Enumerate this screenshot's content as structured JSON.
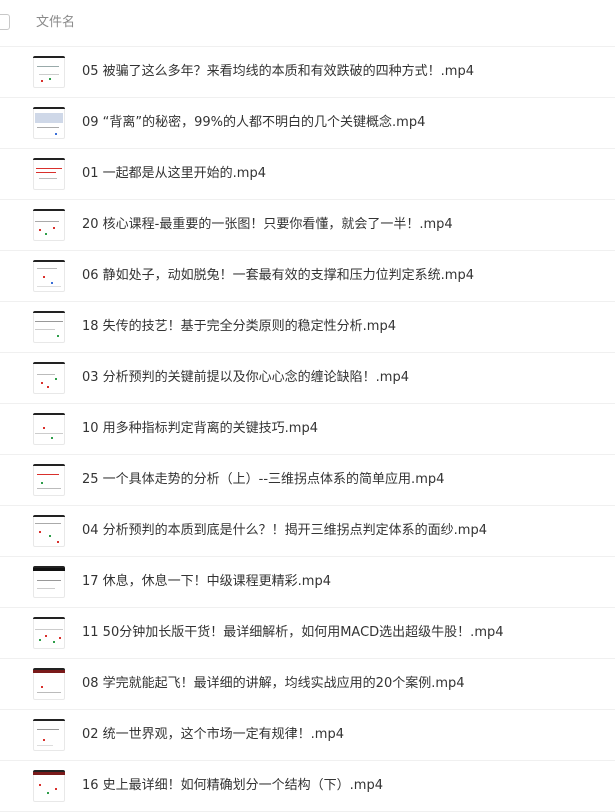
{
  "header": {
    "column_title": "文件名"
  },
  "files": [
    {
      "name": "05 被骗了这么多年？来看均线的本质和有效跌破的四种方式！.mp4",
      "thumb_style": "a"
    },
    {
      "name": "09 “背离”的秘密，99%的人都不明白的几个关键概念.mp4",
      "thumb_style": "b"
    },
    {
      "name": "01 一起都是从这里开始的.mp4",
      "thumb_style": "c"
    },
    {
      "name": "20 核心课程-最重要的一张图！只要你看懂，就会了一半！.mp4",
      "thumb_style": "d"
    },
    {
      "name": "06 静如处子，动如脱兔！一套最有效的支撑和压力位判定系统.mp4",
      "thumb_style": "e"
    },
    {
      "name": "18 失传的技艺！基于完全分类原则的稳定性分析.mp4",
      "thumb_style": "f"
    },
    {
      "name": "03 分析预判的关键前提以及你心心念的缠论缺陷！.mp4",
      "thumb_style": "g"
    },
    {
      "name": "10 用多种指标判定背离的关键技巧.mp4",
      "thumb_style": "h"
    },
    {
      "name": "25 一个具体走势的分析（上）--三维拐点体系的简单应用.mp4",
      "thumb_style": "i"
    },
    {
      "name": "04 分析预判的本质到底是什么？！揭开三维拐点判定体系的面纱.mp4",
      "thumb_style": "j"
    },
    {
      "name": "17 休息，休息一下！中级课程更精彩.mp4",
      "thumb_style": "k"
    },
    {
      "name": "11 50分钟加长版干货！最详细解析，如何用MACD选出超级牛股！.mp4",
      "thumb_style": "l"
    },
    {
      "name": "08 学完就能起飞！最详细的讲解，均线实战应用的20个案例.mp4",
      "thumb_style": "m"
    },
    {
      "name": "02 统一世界观，这个市场一定有规律！.mp4",
      "thumb_style": "n"
    },
    {
      "name": "16 史上最详细！如何精确划分一个结构（下）.mp4",
      "thumb_style": "o"
    }
  ],
  "colors": {
    "text": "#333333",
    "header_text": "#8a8a8a",
    "divider": "#f0f0f0",
    "accent_red": "#d9302c",
    "accent_green": "#2e9e4a",
    "accent_blue": "#3a6fd8"
  }
}
